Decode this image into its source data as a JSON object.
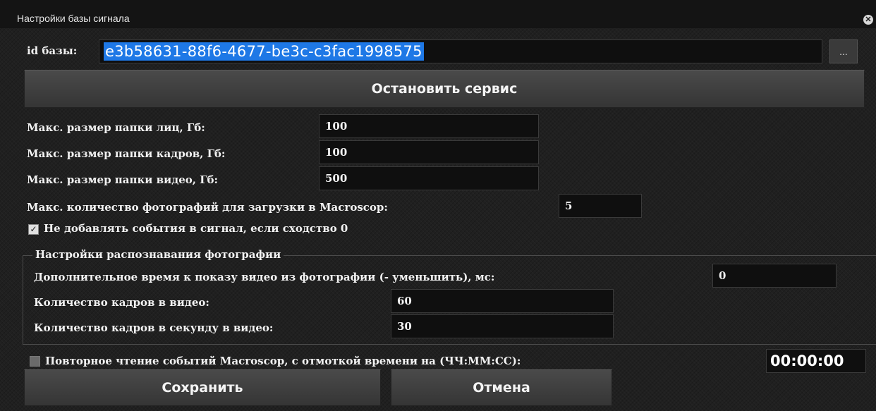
{
  "window": {
    "title": "Настройки базы сигнала",
    "close_icon": "close-icon"
  },
  "base_id": {
    "label": "id базы:",
    "value": "e3b58631-88f6-4677-be3c-c3fac1998575",
    "browse_label": "..."
  },
  "stop_service_button": "Остановить сервис",
  "settings": [
    {
      "label": "Макс. размер папки лиц, Гб:",
      "value": "100"
    },
    {
      "label": "Макс. размер папки кадров, Гб:",
      "value": "100"
    },
    {
      "label": "Макс. размер папки видео, Гб:",
      "value": "500"
    }
  ],
  "max_photos": {
    "label": "Макс. количество фотографий для загрузки в Macroscop:",
    "value": "5"
  },
  "skip_zero_similarity": {
    "label": "Не добавлять события в сигнал, если сходство 0",
    "checked": true
  },
  "photo_recognition": {
    "title": "Настройки распознавания фотографии",
    "extra_time": {
      "label": "Дополнительное время к показу видео из фотографии (- уменьшить), мс:",
      "value": "0"
    },
    "frames": {
      "label": "Количество кадров в видео:",
      "value": "60"
    },
    "fps": {
      "label": "Количество кадров в секунду в видео:",
      "value": "30"
    }
  },
  "reread_events": {
    "label": "Повторное чтение событий Macroscop, с отмоткой времени на (ЧЧ:ММ:СС):",
    "checked": false,
    "value": "00:00:00"
  },
  "buttons": {
    "save": "Сохранить",
    "cancel": "Отмена"
  }
}
